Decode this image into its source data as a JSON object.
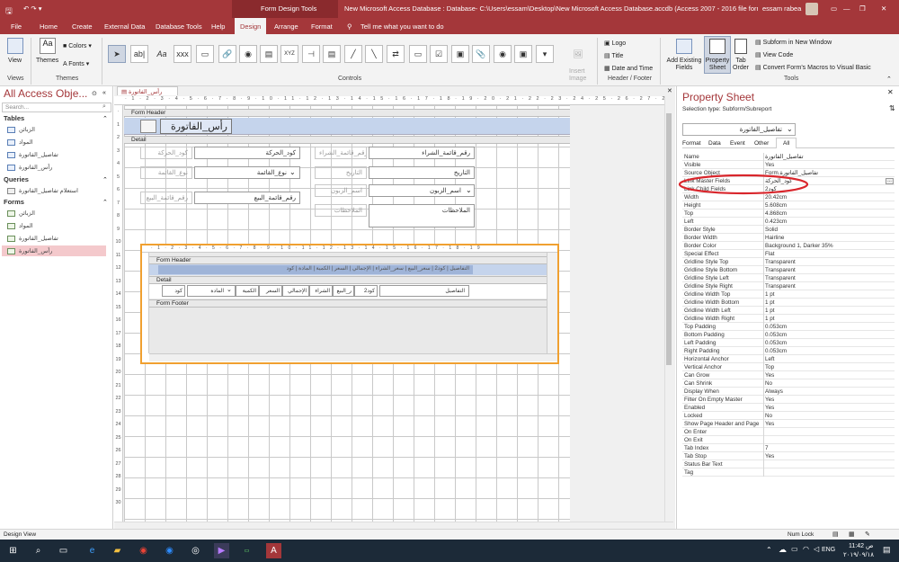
{
  "titlebar": {
    "context_tab": "Form Design Tools",
    "doc_title": "New Microsoft Access Database : Database- C:\\Users\\essam\\Desktop\\New Microsoft Access Database.accdb (Access 2007 - 2016 file format) -...",
    "user": "essam rabea"
  },
  "menu": {
    "tabs": [
      "File",
      "Home",
      "Create",
      "External Data",
      "Database Tools",
      "Help",
      "Design",
      "Arrange",
      "Format"
    ],
    "tell_me": "Tell me what you want to do"
  },
  "ribbon": {
    "views": {
      "view_label": "View",
      "group": "Views"
    },
    "themes": {
      "themes_label": "Themes",
      "colors_label": "Colors",
      "fonts_label": "Fonts",
      "group": "Themes"
    },
    "controls": {
      "group": "Controls",
      "insert_image": "Insert Image"
    },
    "header_footer": {
      "logo": "Logo",
      "title": "Title",
      "date_time": "Date and Time",
      "group": "Header / Footer"
    },
    "tools": {
      "add_existing": "Add Existing Fields",
      "property_sheet": "Property Sheet",
      "tab_order": "Tab Order",
      "subform_new_window": "Subform in New Window",
      "view_code": "View Code",
      "convert_macros": "Convert Form's Macros to Visual Basic",
      "group": "Tools"
    }
  },
  "nav": {
    "title": "All Access Obje...",
    "search_placeholder": "Search...",
    "sections": [
      {
        "name": "Tables",
        "items": [
          "الزبائن",
          "المواد",
          "تفاصيل_الفاتورة",
          "رأس_الفاتورة"
        ]
      },
      {
        "name": "Queries",
        "items": [
          "استعلام تفاصيل_الفاتورة"
        ]
      },
      {
        "name": "Forms",
        "items": [
          "الزبائن",
          "المواد",
          "تفاصيل_الفاتورة",
          "رأس_الفاتورة"
        ]
      }
    ]
  },
  "doc": {
    "tab_label": "رأس_الفاتورة",
    "form_header": "Form Header",
    "detail": "Detail",
    "form_title": "رأس_الفاتورة",
    "fields": {
      "kod_haraka": "كود_الحركة",
      "kod_haraka_lbl": "كود_الحركة",
      "naw_qaima": "نوع_القائمة",
      "naw_qaima_lbl": "نوع_القائمة",
      "raqm_bay": "رقم_قائمة_البيع",
      "raqm_bay_lbl": "رقم_قائمة_البيع",
      "raqm_shira": "رقم_قائمة_الشراء",
      "raqm_shira_lbl": "رقم_قائمة_الشراء",
      "tarikh": "التاريخ",
      "tarikh_lbl": "التاريخ",
      "zaboon": "اسم_الزبون",
      "zaboon_lbl": "اسم_الزبون",
      "mulahazat": "الملاحظات",
      "mulahazat_lbl": "الملاحظات"
    },
    "subform": {
      "form_header": "Form Header",
      "detail": "Detail",
      "form_footer": "Form Footer",
      "header_row": "التفاصيل | كود2 | سعر_البيع | سعر_الشراء | الإجمالي | السعر | الكمية | المادة | كود",
      "detail_cells": [
        "التفاصيل",
        "كود2",
        "ر_البيع",
        "الشراء",
        "الإجمالي",
        "السعر",
        "الكمية",
        "المادة",
        "كود"
      ]
    }
  },
  "props": {
    "title": "Property Sheet",
    "selection_type": "Selection type:  Subform/Subreport",
    "selected_object": "تفاصيل_الفاتورة",
    "tabs": [
      "Format",
      "Data",
      "Event",
      "Other",
      "All"
    ],
    "rows": [
      {
        "name": "Name",
        "value": "تفاصيل_الفاتورة"
      },
      {
        "name": "Visible",
        "value": "Yes"
      },
      {
        "name": "Source Object",
        "value": "Form.تفاصيل_الفاتورة"
      },
      {
        "name": "Link Master Fields",
        "value": "كود_الحركة"
      },
      {
        "name": "Link Child Fields",
        "value": "كود2"
      },
      {
        "name": "Width",
        "value": "20.42cm"
      },
      {
        "name": "Height",
        "value": "5.608cm"
      },
      {
        "name": "Top",
        "value": "4.868cm"
      },
      {
        "name": "Left",
        "value": "0.423cm"
      },
      {
        "name": "Border Style",
        "value": "Solid"
      },
      {
        "name": "Border Width",
        "value": "Hairline"
      },
      {
        "name": "Border Color",
        "value": "Background 1, Darker 35%"
      },
      {
        "name": "Special Effect",
        "value": "Flat"
      },
      {
        "name": "Gridline Style Top",
        "value": "Transparent"
      },
      {
        "name": "Gridline Style Bottom",
        "value": "Transparent"
      },
      {
        "name": "Gridline Style Left",
        "value": "Transparent"
      },
      {
        "name": "Gridline Style Right",
        "value": "Transparent"
      },
      {
        "name": "Gridline Width Top",
        "value": "1 pt"
      },
      {
        "name": "Gridline Width Bottom",
        "value": "1 pt"
      },
      {
        "name": "Gridline Width Left",
        "value": "1 pt"
      },
      {
        "name": "Gridline Width Right",
        "value": "1 pt"
      },
      {
        "name": "Top Padding",
        "value": "0.053cm"
      },
      {
        "name": "Bottom Padding",
        "value": "0.053cm"
      },
      {
        "name": "Left Padding",
        "value": "0.053cm"
      },
      {
        "name": "Right Padding",
        "value": "0.053cm"
      },
      {
        "name": "Horizontal Anchor",
        "value": "Left"
      },
      {
        "name": "Vertical Anchor",
        "value": "Top"
      },
      {
        "name": "Can Grow",
        "value": "Yes"
      },
      {
        "name": "Can Shrink",
        "value": "No"
      },
      {
        "name": "Display When",
        "value": "Always"
      },
      {
        "name": "Filter On Empty Master",
        "value": "Yes"
      },
      {
        "name": "Enabled",
        "value": "Yes"
      },
      {
        "name": "Locked",
        "value": "No"
      },
      {
        "name": "Show Page Header and Page",
        "value": "Yes"
      },
      {
        "name": "On Enter",
        "value": ""
      },
      {
        "name": "On Exit",
        "value": ""
      },
      {
        "name": "Tab Index",
        "value": "7"
      },
      {
        "name": "Tab Stop",
        "value": "Yes"
      },
      {
        "name": "Status Bar Text",
        "value": ""
      },
      {
        "name": "Tag",
        "value": ""
      }
    ]
  },
  "status": {
    "left": "Design View",
    "num_lock": "Num Lock"
  },
  "taskbar": {
    "lang": "ENG",
    "time": "11:42 ص",
    "date": "٢٠١٩/٠٩/١٨"
  },
  "colors": {
    "accent": "#a4373a",
    "highlight_oval": "#d9262c"
  }
}
